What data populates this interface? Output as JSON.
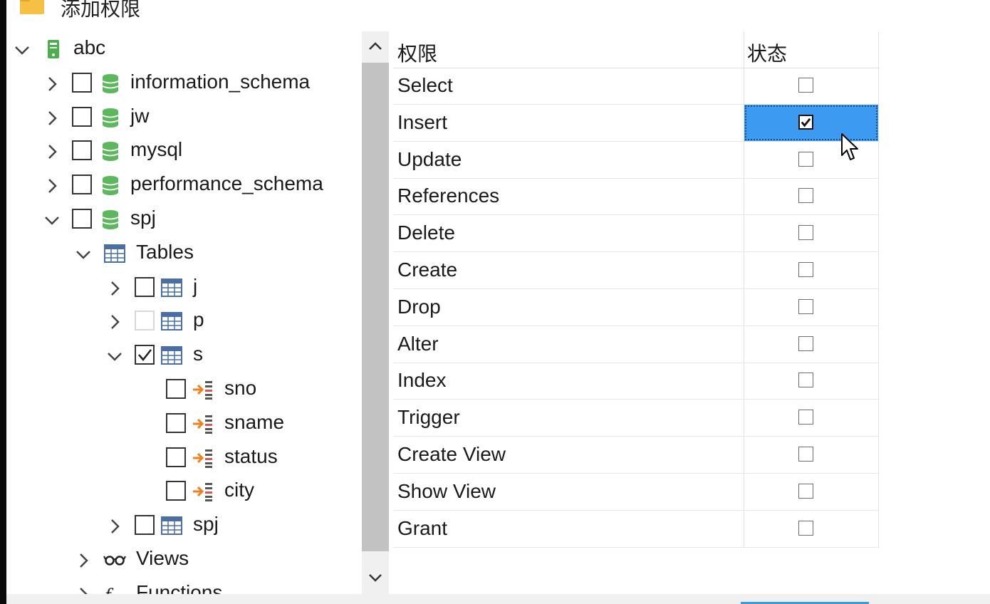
{
  "window": {
    "title": "添加权限"
  },
  "tree": {
    "root": {
      "label": "abc",
      "expanded": true
    },
    "databases": [
      {
        "label": "information_schema",
        "expanded": false,
        "checked": false
      },
      {
        "label": "jw",
        "expanded": false,
        "checked": false
      },
      {
        "label": "mysql",
        "expanded": false,
        "checked": false
      },
      {
        "label": "performance_schema",
        "expanded": false,
        "checked": false
      },
      {
        "label": "spj",
        "expanded": true,
        "checked": false
      }
    ],
    "tables_group": {
      "label": "Tables",
      "expanded": true
    },
    "tables": [
      {
        "label": "j",
        "expanded": false,
        "checked": false
      },
      {
        "label": "p",
        "expanded": false,
        "checked": false
      },
      {
        "label": "s",
        "expanded": true,
        "checked": true
      },
      {
        "label": "spj",
        "expanded": false,
        "checked": false
      }
    ],
    "columns": [
      {
        "label": "sno",
        "checked": false
      },
      {
        "label": "sname",
        "checked": false
      },
      {
        "label": "status",
        "checked": false
      },
      {
        "label": "city",
        "checked": false
      }
    ],
    "views_group": {
      "label": "Views",
      "expanded": false
    },
    "functions_group": {
      "label": "Functions",
      "expanded": false
    }
  },
  "grid": {
    "headers": {
      "privilege": "权限",
      "status": "状态"
    },
    "rows": [
      {
        "name": "Select",
        "checked": false
      },
      {
        "name": "Insert",
        "checked": true,
        "selected": true
      },
      {
        "name": "Update",
        "checked": false
      },
      {
        "name": "References",
        "checked": false
      },
      {
        "name": "Delete",
        "checked": false
      },
      {
        "name": "Create",
        "checked": false
      },
      {
        "name": "Drop",
        "checked": false
      },
      {
        "name": "Alter",
        "checked": false
      },
      {
        "name": "Index",
        "checked": false
      },
      {
        "name": "Trigger",
        "checked": false
      },
      {
        "name": "Create View",
        "checked": false
      },
      {
        "name": "Show View",
        "checked": false
      },
      {
        "name": "Grant",
        "checked": false
      }
    ]
  },
  "colors": {
    "selection": "#3c9af0",
    "db_icon": "#5cb85c",
    "column_icon_arrow": "#f07f1c",
    "column_icon_bars": "#d9534f",
    "table_icon": "#4a6fa5",
    "scroll_thumb": "#c2c2c2"
  }
}
